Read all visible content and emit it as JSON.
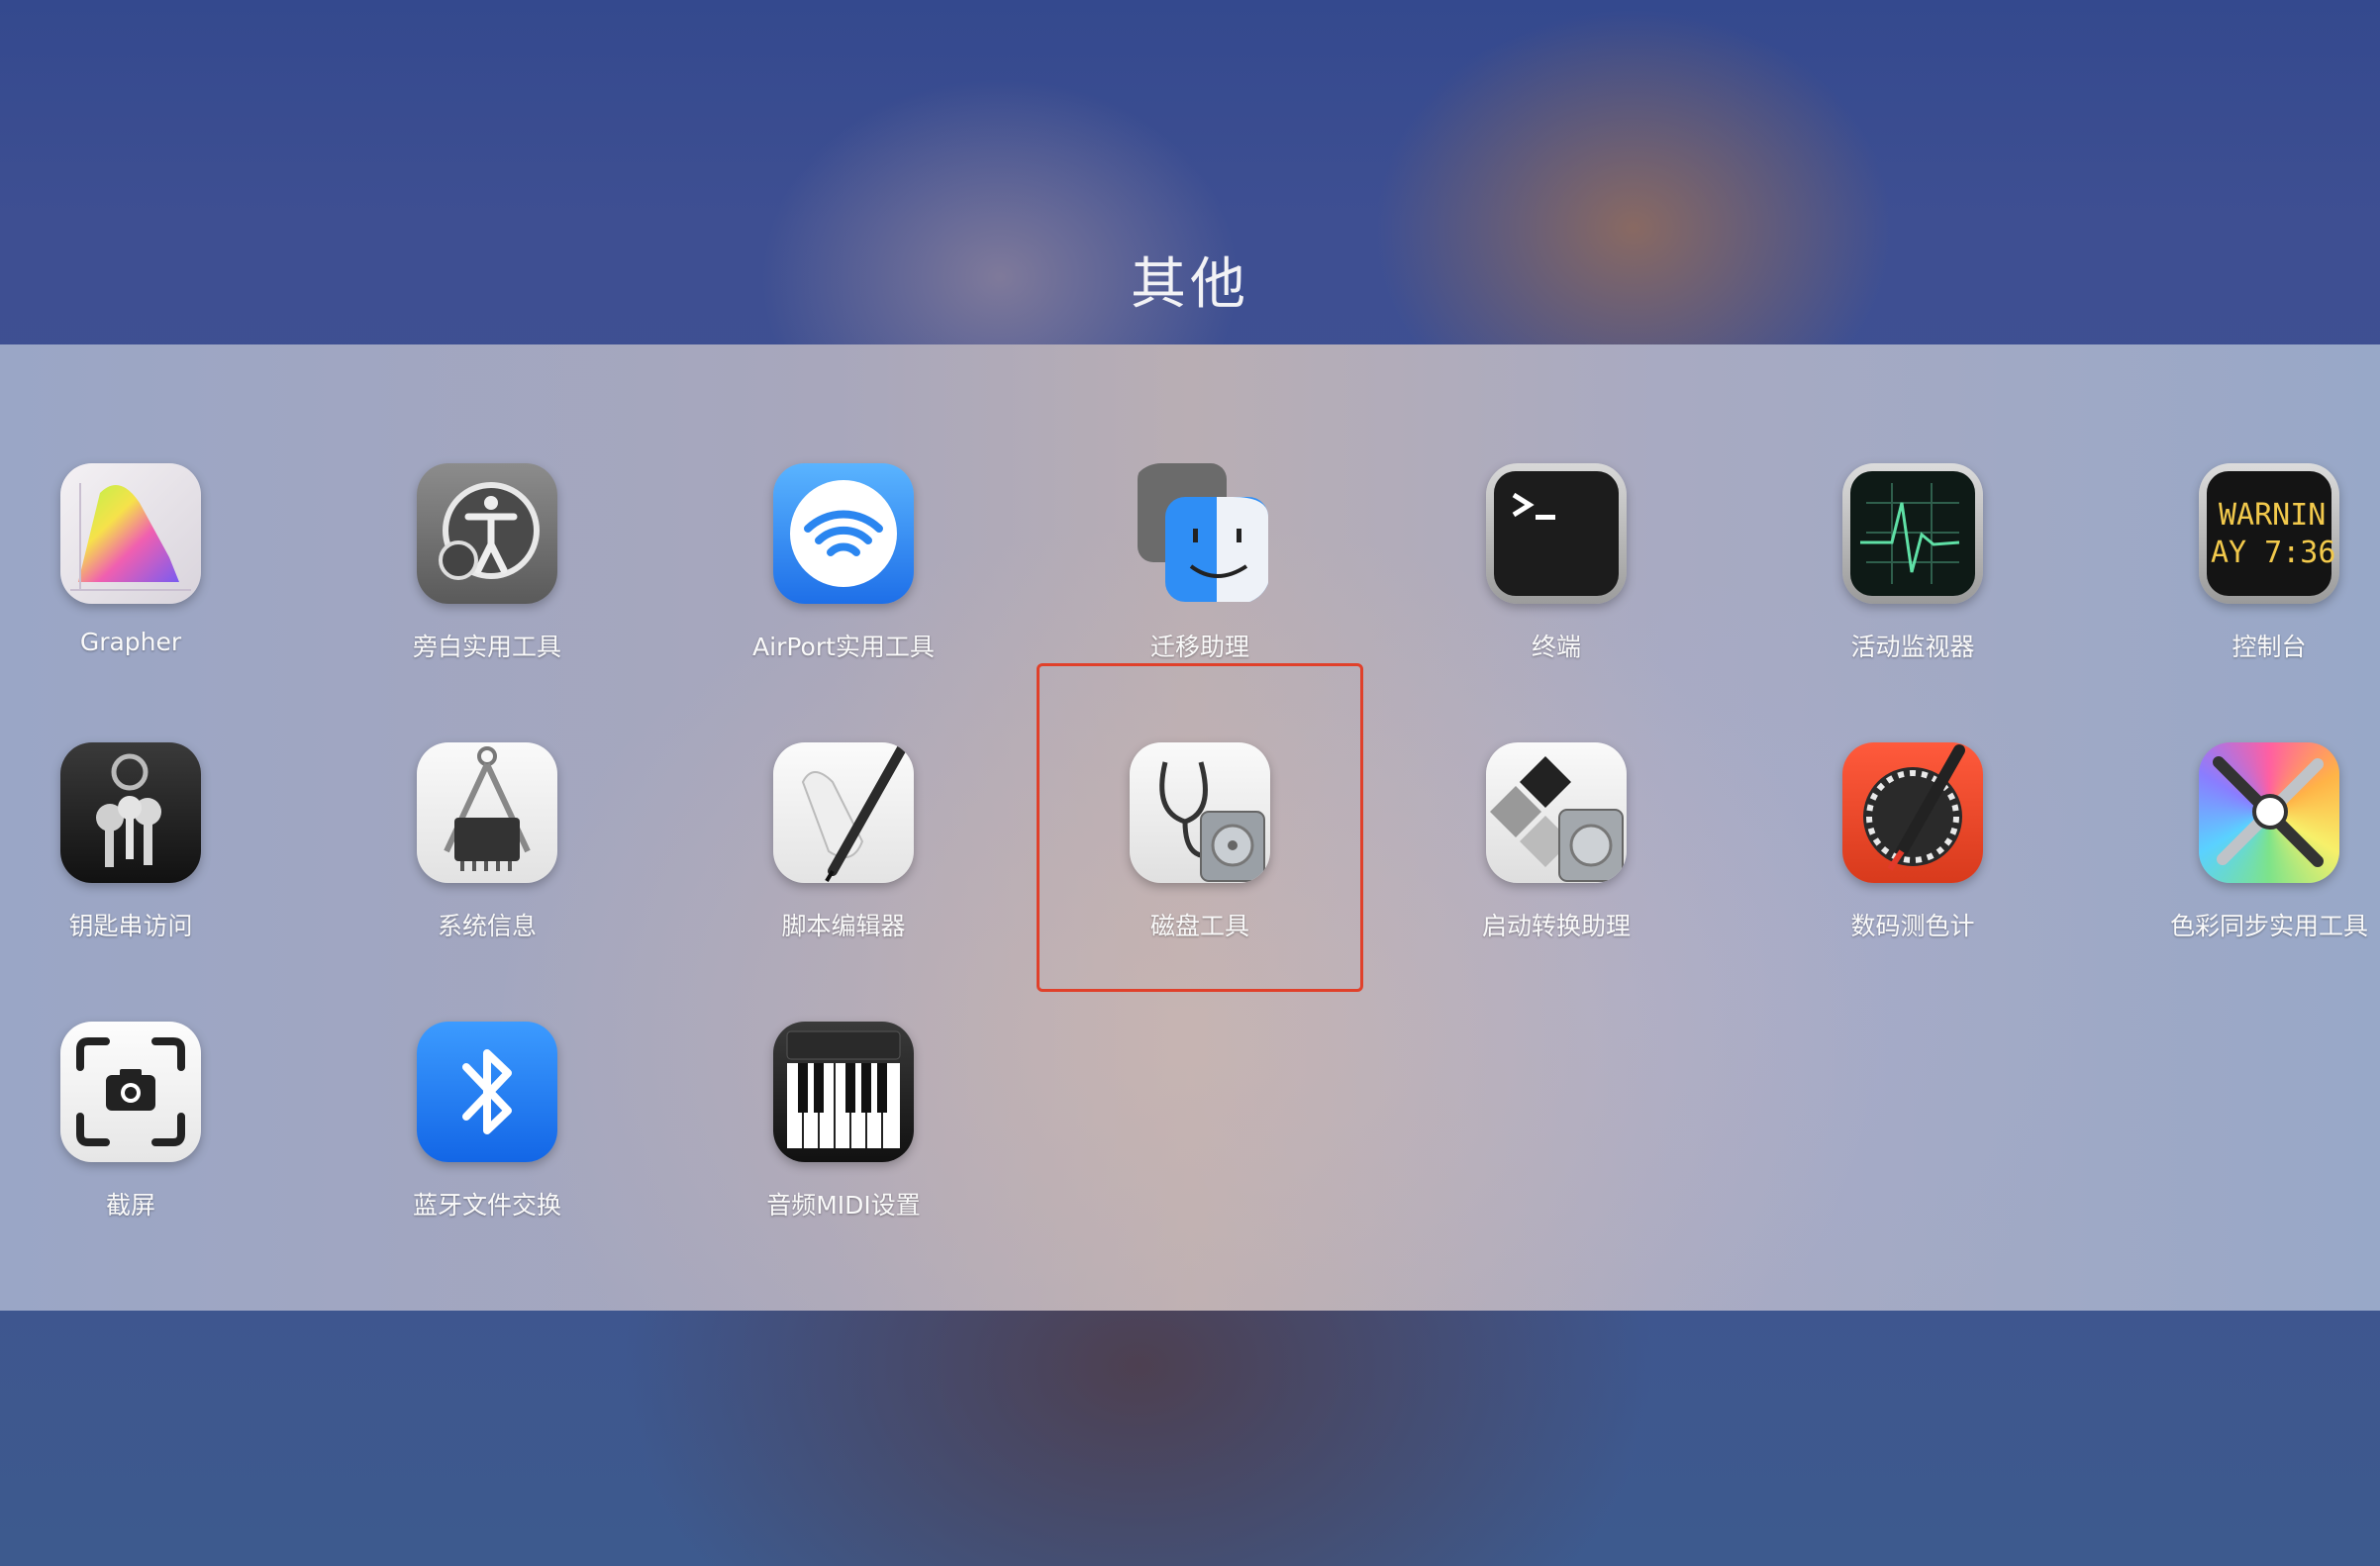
{
  "folder": {
    "title": "其他"
  },
  "apps": [
    {
      "label": "Grapher",
      "icon": "grapher-icon"
    },
    {
      "label": "旁白实用工具",
      "icon": "voiceover-utility-icon"
    },
    {
      "label": "AirPort实用工具",
      "icon": "airport-utility-icon"
    },
    {
      "label": "迁移助理",
      "icon": "migration-assistant-icon"
    },
    {
      "label": "终端",
      "icon": "terminal-icon"
    },
    {
      "label": "活动监视器",
      "icon": "activity-monitor-icon"
    },
    {
      "label": "控制台",
      "icon": "console-icon",
      "icon_text": [
        "WARNIN",
        "AY 7:36"
      ]
    },
    {
      "label": "钥匙串访问",
      "icon": "keychain-access-icon"
    },
    {
      "label": "系统信息",
      "icon": "system-information-icon"
    },
    {
      "label": "脚本编辑器",
      "icon": "script-editor-icon"
    },
    {
      "label": "磁盘工具",
      "icon": "disk-utility-icon",
      "highlighted": true
    },
    {
      "label": "启动转换助理",
      "icon": "boot-camp-assistant-icon"
    },
    {
      "label": "数码测色计",
      "icon": "digital-color-meter-icon"
    },
    {
      "label": "色彩同步实用工具",
      "icon": "colorsync-utility-icon"
    },
    {
      "label": "截屏",
      "icon": "screenshot-icon"
    },
    {
      "label": "蓝牙文件交换",
      "icon": "bluetooth-file-exchange-icon"
    },
    {
      "label": "音频MIDI设置",
      "icon": "audio-midi-setup-icon"
    }
  ],
  "colors": {
    "highlight": "#e0402a",
    "label": "#fafafa"
  }
}
